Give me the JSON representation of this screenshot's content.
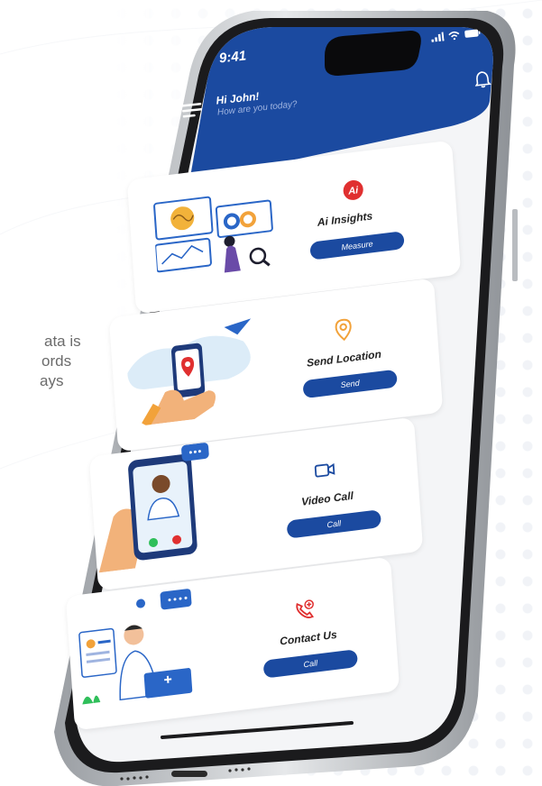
{
  "side_text": {
    "line1": "ata is",
    "line2": "ords",
    "line3": "ays"
  },
  "status": {
    "time": "9:41"
  },
  "header": {
    "greeting": "Hi John!",
    "subtitle": "How are you today?"
  },
  "cards": [
    {
      "title": "Ai Insights",
      "button": "Measure",
      "icon": "ai-logo-icon"
    },
    {
      "title": "Send Location",
      "button": "Send",
      "icon": "location-pin-icon"
    },
    {
      "title": "Video Call",
      "button": "Call",
      "icon": "video-camera-icon"
    },
    {
      "title": "Contact Us",
      "button": "Call",
      "icon": "phone-plus-icon"
    }
  ],
  "colors": {
    "primary": "#1b4aa0",
    "accent": "#e03030",
    "location": "#f2a23a"
  }
}
